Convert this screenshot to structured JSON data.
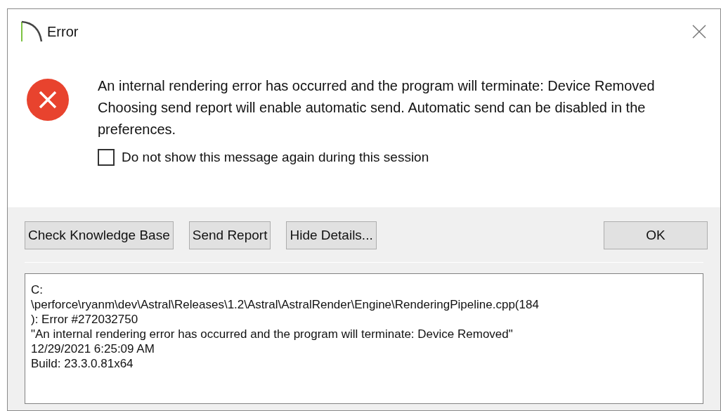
{
  "window": {
    "title": "Error"
  },
  "messages": [
    "An internal rendering error has occurred and the program will terminate: Device Removed",
    "Choosing send report will enable automatic send. Automatic send can be disabled in the preferences."
  ],
  "checkbox": {
    "label": "Do not show this message again during this session",
    "checked": false
  },
  "buttons": [
    {
      "label": "Check Knowledge Base",
      "kind": "left"
    },
    {
      "label": "Send Report",
      "kind": "left"
    },
    {
      "label": "Hide Details...",
      "kind": "left"
    },
    {
      "label": "OK",
      "kind": "right"
    }
  ],
  "details": [
    "C:",
    "\\perforce\\ryanm\\dev\\Astral\\Releases\\1.2\\Astral\\AstralRender\\Engine\\RenderingPipeline.cpp(184",
    "): Error #272032750",
    "\"An internal rendering error has occurred and the program will terminate: Device Removed\"",
    "12/29/2021 6:25:09 AM",
    "Build: 23.3.0.81x64"
  ]
}
